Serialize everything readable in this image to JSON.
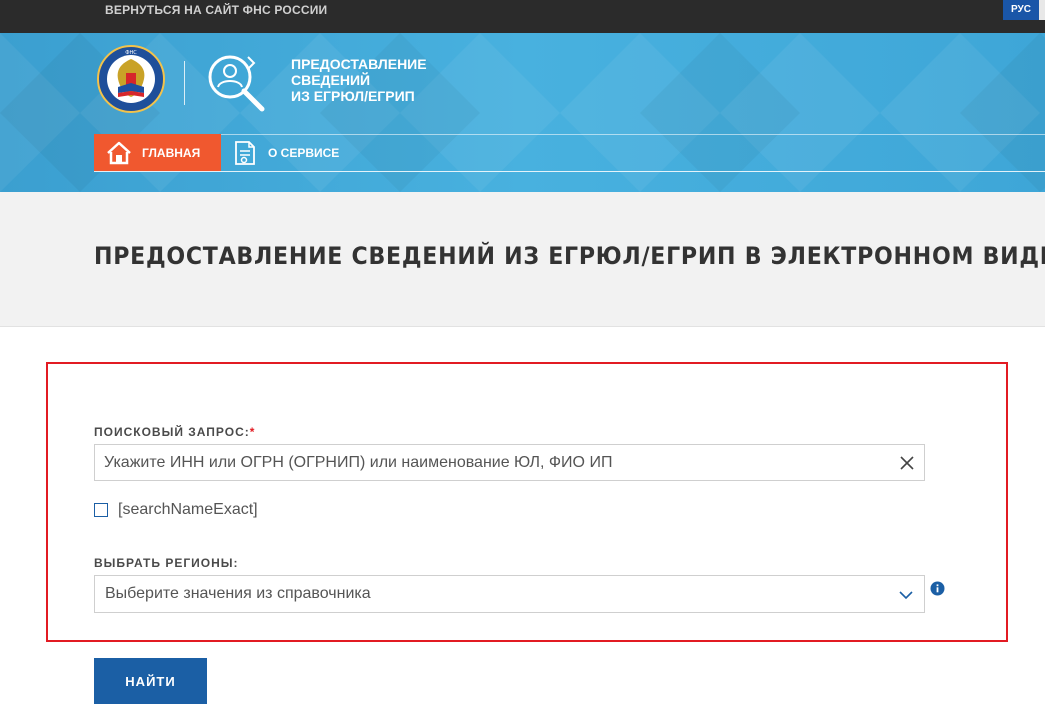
{
  "topbar": {
    "back_link": "ВЕРНУТЬСЯ НА САЙТ ФНС РОССИИ",
    "lang": "РУС"
  },
  "header": {
    "emblem_icon": "fns-emblem-icon",
    "service_icon": "service-search-icon",
    "service_title_lines": [
      "ПРЕДОСТАВЛЕНИЕ",
      "СВЕДЕНИЙ",
      "ИЗ ЕГРЮЛ/ЕГРИП"
    ],
    "nav": [
      {
        "label": "ГЛАВНАЯ",
        "icon": "home-icon",
        "active": true
      },
      {
        "label": "О СЕРВИСЕ",
        "icon": "document-icon",
        "active": false
      }
    ]
  },
  "page": {
    "title": "ПРЕДОСТАВЛЕНИЕ СВЕДЕНИЙ ИЗ ЕГРЮЛ/ЕГРИП В ЭЛЕКТРОННОМ ВИДЕ"
  },
  "form": {
    "search_label": "ПОИСКОВЫЙ ЗАПРОС:",
    "required_mark": "*",
    "search_value": "",
    "search_placeholder": "Укажите ИНН или ОГРН (ОГРНИП) или наименование ЮЛ, ФИО ИП",
    "exact_checkbox_label": "[searchNameExact]",
    "exact_checked": false,
    "regions_label": "ВЫБРАТЬ РЕГИОНЫ:",
    "regions_value": "Выберите значения из справочника",
    "submit_label": "НАЙТИ"
  },
  "colors": {
    "topbar_bg": "#2b2b2b",
    "header_bg": "#3fa7d6",
    "nav_active": "#f0582f",
    "primary": "#1b5fa5",
    "highlight_border": "#e21b23",
    "title_band_bg": "#f2f2f2"
  }
}
